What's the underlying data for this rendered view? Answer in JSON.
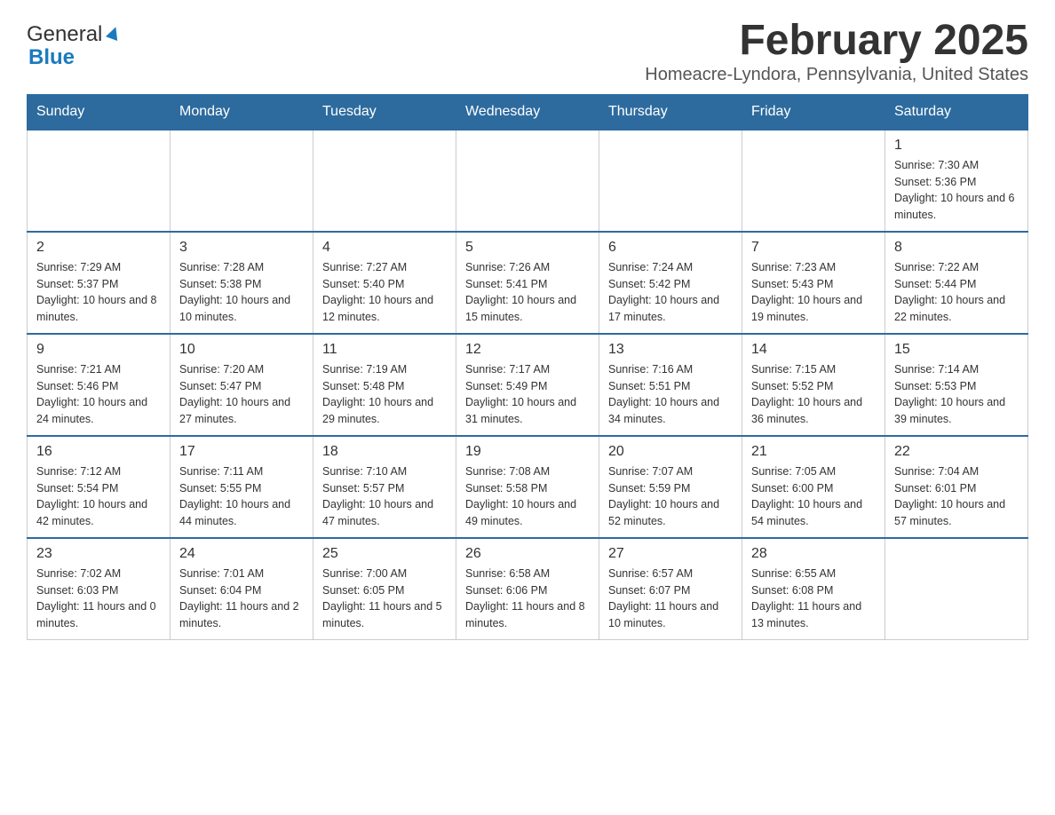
{
  "header": {
    "logo": {
      "general": "General",
      "blue": "Blue"
    },
    "title": "February 2025",
    "subtitle": "Homeacre-Lyndora, Pennsylvania, United States"
  },
  "weekdays": [
    "Sunday",
    "Monday",
    "Tuesday",
    "Wednesday",
    "Thursday",
    "Friday",
    "Saturday"
  ],
  "weeks": [
    [
      {
        "day": "",
        "info": ""
      },
      {
        "day": "",
        "info": ""
      },
      {
        "day": "",
        "info": ""
      },
      {
        "day": "",
        "info": ""
      },
      {
        "day": "",
        "info": ""
      },
      {
        "day": "",
        "info": ""
      },
      {
        "day": "1",
        "info": "Sunrise: 7:30 AM\nSunset: 5:36 PM\nDaylight: 10 hours and 6 minutes."
      }
    ],
    [
      {
        "day": "2",
        "info": "Sunrise: 7:29 AM\nSunset: 5:37 PM\nDaylight: 10 hours and 8 minutes."
      },
      {
        "day": "3",
        "info": "Sunrise: 7:28 AM\nSunset: 5:38 PM\nDaylight: 10 hours and 10 minutes."
      },
      {
        "day": "4",
        "info": "Sunrise: 7:27 AM\nSunset: 5:40 PM\nDaylight: 10 hours and 12 minutes."
      },
      {
        "day": "5",
        "info": "Sunrise: 7:26 AM\nSunset: 5:41 PM\nDaylight: 10 hours and 15 minutes."
      },
      {
        "day": "6",
        "info": "Sunrise: 7:24 AM\nSunset: 5:42 PM\nDaylight: 10 hours and 17 minutes."
      },
      {
        "day": "7",
        "info": "Sunrise: 7:23 AM\nSunset: 5:43 PM\nDaylight: 10 hours and 19 minutes."
      },
      {
        "day": "8",
        "info": "Sunrise: 7:22 AM\nSunset: 5:44 PM\nDaylight: 10 hours and 22 minutes."
      }
    ],
    [
      {
        "day": "9",
        "info": "Sunrise: 7:21 AM\nSunset: 5:46 PM\nDaylight: 10 hours and 24 minutes."
      },
      {
        "day": "10",
        "info": "Sunrise: 7:20 AM\nSunset: 5:47 PM\nDaylight: 10 hours and 27 minutes."
      },
      {
        "day": "11",
        "info": "Sunrise: 7:19 AM\nSunset: 5:48 PM\nDaylight: 10 hours and 29 minutes."
      },
      {
        "day": "12",
        "info": "Sunrise: 7:17 AM\nSunset: 5:49 PM\nDaylight: 10 hours and 31 minutes."
      },
      {
        "day": "13",
        "info": "Sunrise: 7:16 AM\nSunset: 5:51 PM\nDaylight: 10 hours and 34 minutes."
      },
      {
        "day": "14",
        "info": "Sunrise: 7:15 AM\nSunset: 5:52 PM\nDaylight: 10 hours and 36 minutes."
      },
      {
        "day": "15",
        "info": "Sunrise: 7:14 AM\nSunset: 5:53 PM\nDaylight: 10 hours and 39 minutes."
      }
    ],
    [
      {
        "day": "16",
        "info": "Sunrise: 7:12 AM\nSunset: 5:54 PM\nDaylight: 10 hours and 42 minutes."
      },
      {
        "day": "17",
        "info": "Sunrise: 7:11 AM\nSunset: 5:55 PM\nDaylight: 10 hours and 44 minutes."
      },
      {
        "day": "18",
        "info": "Sunrise: 7:10 AM\nSunset: 5:57 PM\nDaylight: 10 hours and 47 minutes."
      },
      {
        "day": "19",
        "info": "Sunrise: 7:08 AM\nSunset: 5:58 PM\nDaylight: 10 hours and 49 minutes."
      },
      {
        "day": "20",
        "info": "Sunrise: 7:07 AM\nSunset: 5:59 PM\nDaylight: 10 hours and 52 minutes."
      },
      {
        "day": "21",
        "info": "Sunrise: 7:05 AM\nSunset: 6:00 PM\nDaylight: 10 hours and 54 minutes."
      },
      {
        "day": "22",
        "info": "Sunrise: 7:04 AM\nSunset: 6:01 PM\nDaylight: 10 hours and 57 minutes."
      }
    ],
    [
      {
        "day": "23",
        "info": "Sunrise: 7:02 AM\nSunset: 6:03 PM\nDaylight: 11 hours and 0 minutes."
      },
      {
        "day": "24",
        "info": "Sunrise: 7:01 AM\nSunset: 6:04 PM\nDaylight: 11 hours and 2 minutes."
      },
      {
        "day": "25",
        "info": "Sunrise: 7:00 AM\nSunset: 6:05 PM\nDaylight: 11 hours and 5 minutes."
      },
      {
        "day": "26",
        "info": "Sunrise: 6:58 AM\nSunset: 6:06 PM\nDaylight: 11 hours and 8 minutes."
      },
      {
        "day": "27",
        "info": "Sunrise: 6:57 AM\nSunset: 6:07 PM\nDaylight: 11 hours and 10 minutes."
      },
      {
        "day": "28",
        "info": "Sunrise: 6:55 AM\nSunset: 6:08 PM\nDaylight: 11 hours and 13 minutes."
      },
      {
        "day": "",
        "info": ""
      }
    ]
  ]
}
